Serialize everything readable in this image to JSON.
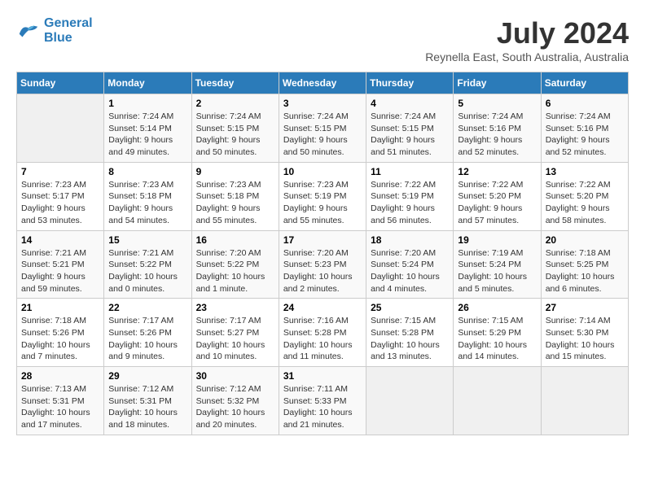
{
  "header": {
    "logo_line1": "General",
    "logo_line2": "Blue",
    "month_year": "July 2024",
    "location": "Reynella East, South Australia, Australia"
  },
  "weekdays": [
    "Sunday",
    "Monday",
    "Tuesday",
    "Wednesday",
    "Thursday",
    "Friday",
    "Saturday"
  ],
  "weeks": [
    [
      {
        "day": "",
        "sunrise": "",
        "sunset": "",
        "daylight": "",
        "empty": true
      },
      {
        "day": "1",
        "sunrise": "Sunrise: 7:24 AM",
        "sunset": "Sunset: 5:14 PM",
        "daylight": "Daylight: 9 hours and 49 minutes.",
        "empty": false
      },
      {
        "day": "2",
        "sunrise": "Sunrise: 7:24 AM",
        "sunset": "Sunset: 5:15 PM",
        "daylight": "Daylight: 9 hours and 50 minutes.",
        "empty": false
      },
      {
        "day": "3",
        "sunrise": "Sunrise: 7:24 AM",
        "sunset": "Sunset: 5:15 PM",
        "daylight": "Daylight: 9 hours and 50 minutes.",
        "empty": false
      },
      {
        "day": "4",
        "sunrise": "Sunrise: 7:24 AM",
        "sunset": "Sunset: 5:15 PM",
        "daylight": "Daylight: 9 hours and 51 minutes.",
        "empty": false
      },
      {
        "day": "5",
        "sunrise": "Sunrise: 7:24 AM",
        "sunset": "Sunset: 5:16 PM",
        "daylight": "Daylight: 9 hours and 52 minutes.",
        "empty": false
      },
      {
        "day": "6",
        "sunrise": "Sunrise: 7:24 AM",
        "sunset": "Sunset: 5:16 PM",
        "daylight": "Daylight: 9 hours and 52 minutes.",
        "empty": false
      }
    ],
    [
      {
        "day": "7",
        "sunrise": "Sunrise: 7:23 AM",
        "sunset": "Sunset: 5:17 PM",
        "daylight": "Daylight: 9 hours and 53 minutes.",
        "empty": false
      },
      {
        "day": "8",
        "sunrise": "Sunrise: 7:23 AM",
        "sunset": "Sunset: 5:18 PM",
        "daylight": "Daylight: 9 hours and 54 minutes.",
        "empty": false
      },
      {
        "day": "9",
        "sunrise": "Sunrise: 7:23 AM",
        "sunset": "Sunset: 5:18 PM",
        "daylight": "Daylight: 9 hours and 55 minutes.",
        "empty": false
      },
      {
        "day": "10",
        "sunrise": "Sunrise: 7:23 AM",
        "sunset": "Sunset: 5:19 PM",
        "daylight": "Daylight: 9 hours and 55 minutes.",
        "empty": false
      },
      {
        "day": "11",
        "sunrise": "Sunrise: 7:22 AM",
        "sunset": "Sunset: 5:19 PM",
        "daylight": "Daylight: 9 hours and 56 minutes.",
        "empty": false
      },
      {
        "day": "12",
        "sunrise": "Sunrise: 7:22 AM",
        "sunset": "Sunset: 5:20 PM",
        "daylight": "Daylight: 9 hours and 57 minutes.",
        "empty": false
      },
      {
        "day": "13",
        "sunrise": "Sunrise: 7:22 AM",
        "sunset": "Sunset: 5:20 PM",
        "daylight": "Daylight: 9 hours and 58 minutes.",
        "empty": false
      }
    ],
    [
      {
        "day": "14",
        "sunrise": "Sunrise: 7:21 AM",
        "sunset": "Sunset: 5:21 PM",
        "daylight": "Daylight: 9 hours and 59 minutes.",
        "empty": false
      },
      {
        "day": "15",
        "sunrise": "Sunrise: 7:21 AM",
        "sunset": "Sunset: 5:22 PM",
        "daylight": "Daylight: 10 hours and 0 minutes.",
        "empty": false
      },
      {
        "day": "16",
        "sunrise": "Sunrise: 7:20 AM",
        "sunset": "Sunset: 5:22 PM",
        "daylight": "Daylight: 10 hours and 1 minute.",
        "empty": false
      },
      {
        "day": "17",
        "sunrise": "Sunrise: 7:20 AM",
        "sunset": "Sunset: 5:23 PM",
        "daylight": "Daylight: 10 hours and 2 minutes.",
        "empty": false
      },
      {
        "day": "18",
        "sunrise": "Sunrise: 7:20 AM",
        "sunset": "Sunset: 5:24 PM",
        "daylight": "Daylight: 10 hours and 4 minutes.",
        "empty": false
      },
      {
        "day": "19",
        "sunrise": "Sunrise: 7:19 AM",
        "sunset": "Sunset: 5:24 PM",
        "daylight": "Daylight: 10 hours and 5 minutes.",
        "empty": false
      },
      {
        "day": "20",
        "sunrise": "Sunrise: 7:18 AM",
        "sunset": "Sunset: 5:25 PM",
        "daylight": "Daylight: 10 hours and 6 minutes.",
        "empty": false
      }
    ],
    [
      {
        "day": "21",
        "sunrise": "Sunrise: 7:18 AM",
        "sunset": "Sunset: 5:26 PM",
        "daylight": "Daylight: 10 hours and 7 minutes.",
        "empty": false
      },
      {
        "day": "22",
        "sunrise": "Sunrise: 7:17 AM",
        "sunset": "Sunset: 5:26 PM",
        "daylight": "Daylight: 10 hours and 9 minutes.",
        "empty": false
      },
      {
        "day": "23",
        "sunrise": "Sunrise: 7:17 AM",
        "sunset": "Sunset: 5:27 PM",
        "daylight": "Daylight: 10 hours and 10 minutes.",
        "empty": false
      },
      {
        "day": "24",
        "sunrise": "Sunrise: 7:16 AM",
        "sunset": "Sunset: 5:28 PM",
        "daylight": "Daylight: 10 hours and 11 minutes.",
        "empty": false
      },
      {
        "day": "25",
        "sunrise": "Sunrise: 7:15 AM",
        "sunset": "Sunset: 5:28 PM",
        "daylight": "Daylight: 10 hours and 13 minutes.",
        "empty": false
      },
      {
        "day": "26",
        "sunrise": "Sunrise: 7:15 AM",
        "sunset": "Sunset: 5:29 PM",
        "daylight": "Daylight: 10 hours and 14 minutes.",
        "empty": false
      },
      {
        "day": "27",
        "sunrise": "Sunrise: 7:14 AM",
        "sunset": "Sunset: 5:30 PM",
        "daylight": "Daylight: 10 hours and 15 minutes.",
        "empty": false
      }
    ],
    [
      {
        "day": "28",
        "sunrise": "Sunrise: 7:13 AM",
        "sunset": "Sunset: 5:31 PM",
        "daylight": "Daylight: 10 hours and 17 minutes.",
        "empty": false
      },
      {
        "day": "29",
        "sunrise": "Sunrise: 7:12 AM",
        "sunset": "Sunset: 5:31 PM",
        "daylight": "Daylight: 10 hours and 18 minutes.",
        "empty": false
      },
      {
        "day": "30",
        "sunrise": "Sunrise: 7:12 AM",
        "sunset": "Sunset: 5:32 PM",
        "daylight": "Daylight: 10 hours and 20 minutes.",
        "empty": false
      },
      {
        "day": "31",
        "sunrise": "Sunrise: 7:11 AM",
        "sunset": "Sunset: 5:33 PM",
        "daylight": "Daylight: 10 hours and 21 minutes.",
        "empty": false
      },
      {
        "day": "",
        "sunrise": "",
        "sunset": "",
        "daylight": "",
        "empty": true
      },
      {
        "day": "",
        "sunrise": "",
        "sunset": "",
        "daylight": "",
        "empty": true
      },
      {
        "day": "",
        "sunrise": "",
        "sunset": "",
        "daylight": "",
        "empty": true
      }
    ]
  ]
}
